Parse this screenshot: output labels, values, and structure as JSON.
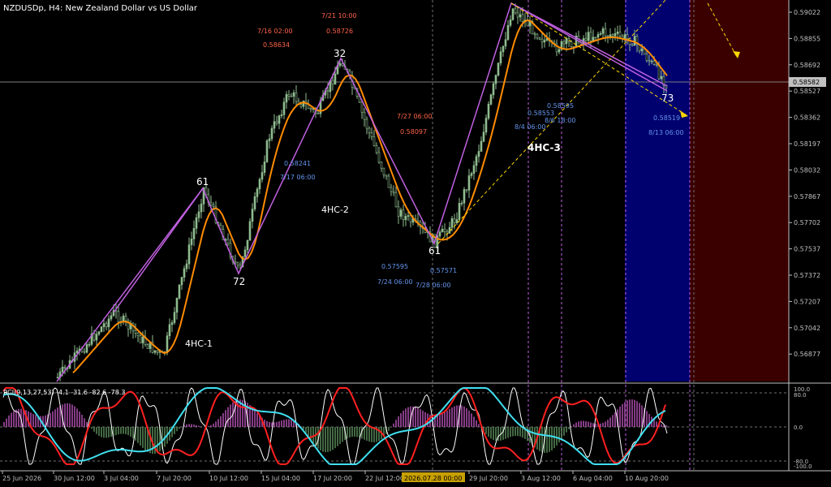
{
  "window": {
    "title": "NZDUSDp, H4:  New Zealand Dollar vs US Dollar"
  },
  "price_axis": {
    "ticks": [
      "0.59022",
      "0.58855",
      "0.58692",
      "0.58527",
      "0.58362",
      "0.58197",
      "0.58032",
      "0.57867",
      "0.57702",
      "0.57537",
      "0.57372",
      "0.57207",
      "0.57042",
      "0.56877"
    ],
    "current_price": "0.58582"
  },
  "time_axis": {
    "ticks": [
      "25 Jun 2026",
      "30 Jun 12:00",
      "3 Jul 04:00",
      "7 Jul 20:00",
      "10 Jul 12:00",
      "15 Jul 04:00",
      "17 Jul 20:00",
      "22 Jul 12:00",
      "29 Jul 20:00",
      "3 Aug 12:00",
      "6 Aug 04:00",
      "10 Aug 20:00"
    ],
    "crosshair_label": "2026.07.28 00:00"
  },
  "wave_labels": {
    "p61a": "61",
    "p72": "72",
    "p32": "32",
    "p61b": "61",
    "p73": "73"
  },
  "cycle_labels": {
    "hc1": "4HC-1",
    "hc2": "4HC-2",
    "hc3": "4HC-3"
  },
  "annotations": {
    "a1_time": "7/16 02:00",
    "a1_price": "0.58634",
    "a2_time": "7/21 10:00",
    "a2_price": "0.58726",
    "a3_price": "0.58241",
    "a3_time": "7/17 06:00",
    "a4_time": "7/27 06:00",
    "a4_price": "0.58097",
    "a5_price": "0.57595",
    "a5_time": "7/24 06:00",
    "a6_price": "0.57571",
    "a6_time": "7/28 06:00",
    "a7_price": "0.58553",
    "a7_time": "8/4 06:00",
    "a8_price": "0.58595",
    "a8_time": "8/6 18:00",
    "a9_price": "0.58519",
    "a9_time": "8/13 06:00"
  },
  "indicator": {
    "label": "RCI(9,13,27,53) -4.1 -31.6 -82.6 -78.3",
    "ticks": [
      "100.0",
      "80.0",
      "0.0",
      "-80.0",
      "-100.0"
    ]
  },
  "colors": {
    "background": "#000000",
    "candles": "#8fbc8f",
    "moving_average": "#ff8c00",
    "wave_lines": "#c060e0",
    "annotation_red": "#ff6347",
    "annotation_blue": "#6495ed",
    "forecast_blue_zone": "#00006e",
    "forecast_red_zone": "#3a0000",
    "trendline_yellow": "#ffd700"
  }
}
